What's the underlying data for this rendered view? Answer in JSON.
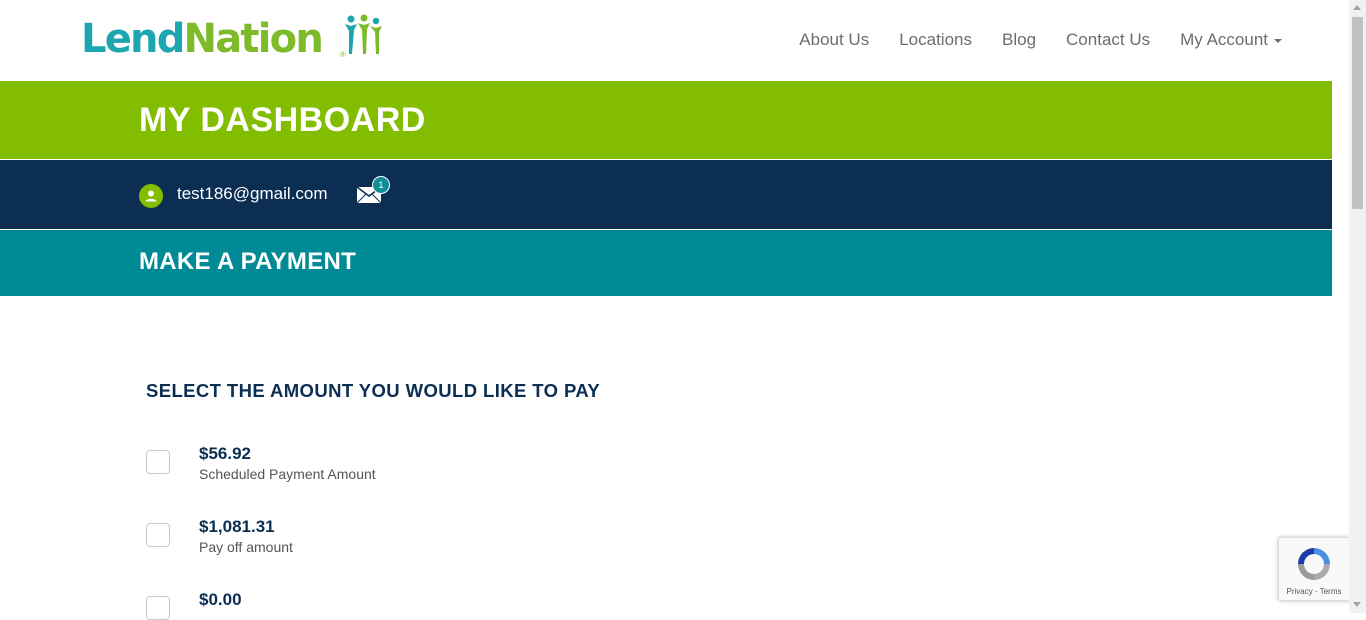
{
  "brand": {
    "name_part1": "Lend",
    "name_part2": "Nation",
    "registered": "®"
  },
  "nav": {
    "items": [
      "About Us",
      "Locations",
      "Blog",
      "Contact Us"
    ],
    "account_label": "My Account"
  },
  "dashboard": {
    "title": "MY DASHBOARD"
  },
  "user": {
    "email": "test186@gmail.com",
    "message_count": "1"
  },
  "payment": {
    "title": "MAKE A PAYMENT",
    "heading": "SELECT THE AMOUNT YOU WOULD LIKE TO PAY",
    "options": [
      {
        "amount": "$56.92",
        "label": "Scheduled Payment Amount"
      },
      {
        "amount": "$1,081.31",
        "label": "Pay off amount"
      },
      {
        "amount": "$0.00",
        "label": ""
      }
    ]
  },
  "recaptcha": {
    "terms": "Privacy - Terms"
  },
  "colors": {
    "green": "#83bd00",
    "navy": "#0b2e52",
    "teal": "#008a96",
    "logo_teal": "#1ea6b0",
    "logo_green": "#7dbb2a"
  },
  "icons": [
    "user-icon",
    "mail-icon",
    "caret-down-icon",
    "recaptcha-icon"
  ]
}
